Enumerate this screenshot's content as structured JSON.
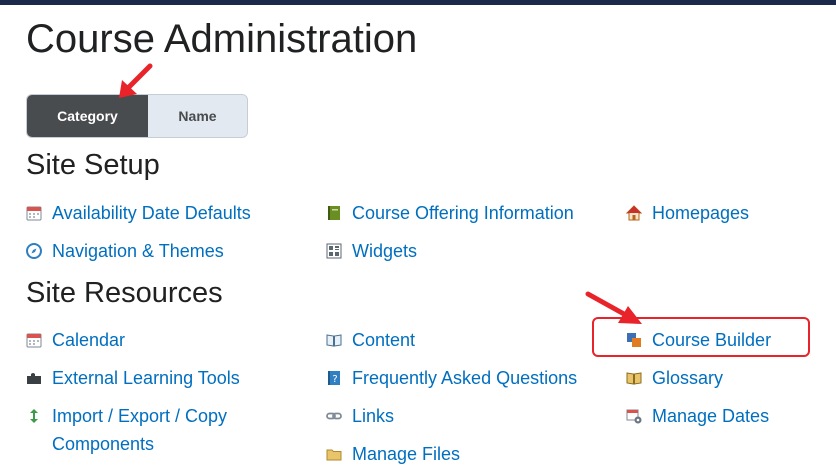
{
  "page": {
    "title": "Course Administration"
  },
  "view_toggle": {
    "category_label": "Category",
    "name_label": "Name",
    "selected": "Category"
  },
  "site_setup": {
    "heading": "Site Setup",
    "items": [
      {
        "label": "Availability Date Defaults",
        "icon": "calendar-icon"
      },
      {
        "label": "Course Offering Information",
        "icon": "book-icon"
      },
      {
        "label": "Homepages",
        "icon": "home-icon"
      },
      {
        "label": "Navigation & Themes",
        "icon": "compass-icon"
      },
      {
        "label": "Widgets",
        "icon": "widget-grid-icon"
      }
    ]
  },
  "site_resources": {
    "heading": "Site Resources",
    "items": [
      {
        "label": "Calendar",
        "icon": "calendar-icon"
      },
      {
        "label": "Content",
        "icon": "open-book-icon"
      },
      {
        "label": "Course Builder",
        "icon": "course-builder-icon"
      },
      {
        "label": "External Learning Tools",
        "icon": "puzzle-icon"
      },
      {
        "label": "Frequently Asked Questions",
        "icon": "faq-icon"
      },
      {
        "label": "Glossary",
        "icon": "glossary-icon"
      },
      {
        "label": "Import / Export / Copy Components",
        "icon": "import-export-icon"
      },
      {
        "label": "Links",
        "icon": "link-icon"
      },
      {
        "label": "Manage Dates",
        "icon": "manage-dates-icon"
      },
      {
        "label": "Manage Files",
        "icon": "folder-icon"
      }
    ]
  },
  "colors": {
    "link": "#006fbf",
    "annotation": "#e8232a",
    "toggle_active": "#494c4e",
    "top_bar": "#1b2a4a"
  }
}
